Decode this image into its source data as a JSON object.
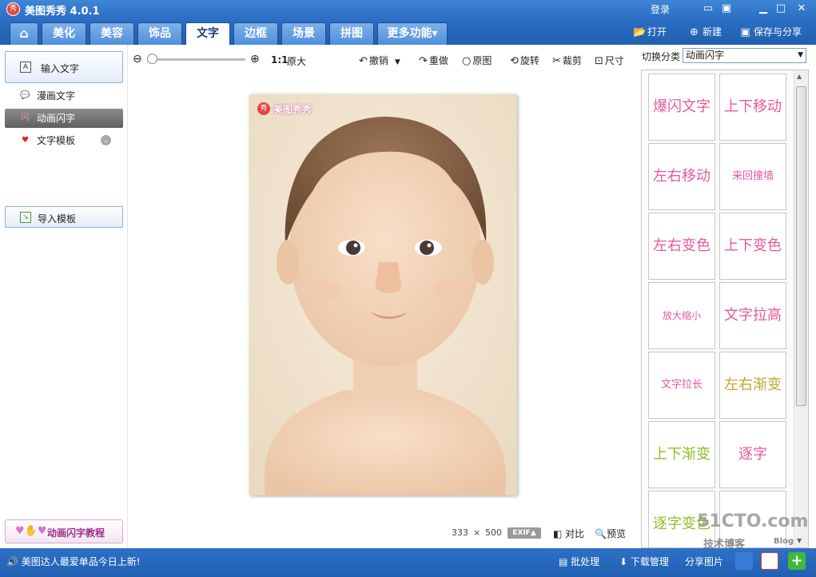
{
  "app": {
    "logo_text": "秀",
    "title": "美图秀秀 4.0.1",
    "login_label": "登录",
    "window_controls": [
      "message-icon",
      "skin-icon",
      "minimize-icon",
      "maximize-icon",
      "close-icon"
    ]
  },
  "tabs": [
    {
      "label": "⌂",
      "icon": "home-icon"
    },
    {
      "label": "美化"
    },
    {
      "label": "美容"
    },
    {
      "label": "饰品"
    },
    {
      "label": "文字",
      "active": true
    },
    {
      "label": "边框"
    },
    {
      "label": "场景"
    },
    {
      "label": "拼图"
    },
    {
      "label": "更多功能▾"
    }
  ],
  "top_actions": {
    "open": "打开",
    "new": "新建",
    "save_share": "保存与分享"
  },
  "left_panel": {
    "input_text_button": "输入文字",
    "items": [
      {
        "label": "漫画文字",
        "icon": "comic-bubble-icon"
      },
      {
        "label": "动画闪字",
        "icon": "flash-text-icon",
        "active": true
      },
      {
        "label": "文字模板",
        "icon": "i-love-you-icon"
      }
    ],
    "import_template": "导入模板",
    "tutorial_button": "动画闪字教程"
  },
  "toolbar": {
    "ratio": "1:1",
    "original_size": "原大",
    "undo": "撤销",
    "redo": "重做",
    "original": "原图",
    "rotate": "旋转",
    "crop": "裁剪",
    "size": "尺寸",
    "zoom_level": 0.0
  },
  "canvas": {
    "watermark_logo": "秀",
    "watermark_text": "美图秀秀",
    "image_width": "333",
    "times": "×",
    "image_height": "500",
    "exif_label": "EXIF▲",
    "compare": "对比",
    "preview": "预览"
  },
  "right_panel": {
    "switch_category_label": "切换分类",
    "selected_category": "动画闪字",
    "tiles": [
      {
        "text": "爆闪文字",
        "color": "#e8589f"
      },
      {
        "text": "上下移动",
        "color": "#e8589f"
      },
      {
        "text": "左右移动",
        "color": "#e8589f"
      },
      {
        "text": "来回撞墙",
        "color": "#e8589f"
      },
      {
        "text": "左右变色",
        "color": "#e8589f"
      },
      {
        "text": "上下变色",
        "color": "#e8589f"
      },
      {
        "text": "放大缩小",
        "color": "#e8589f"
      },
      {
        "text": "文字拉高",
        "color": "#e8589f"
      },
      {
        "text": "文字拉长",
        "color": "#e8589f"
      },
      {
        "text": "左右渐变",
        "color": "#c9a42a"
      },
      {
        "text": "上下渐变",
        "color": "#8cbf26"
      },
      {
        "text": "逐字",
        "color": "#e8589f"
      },
      {
        "text": "逐字变色",
        "color": "#8cbf26"
      },
      {
        "text": "",
        "color": "#e8589f"
      }
    ]
  },
  "status_bar": {
    "announcement": "美图达人最爱单品今日上新!",
    "batch": "批处理",
    "downloads": "下载管理",
    "share_label": "分享图片"
  },
  "watermark": {
    "main": "51CTO.com",
    "sub": "技术博客",
    "blog": "Blog"
  },
  "colors": {
    "chrome_blue": "#2b6ec3",
    "flash_text_pink": "#e8589f"
  }
}
